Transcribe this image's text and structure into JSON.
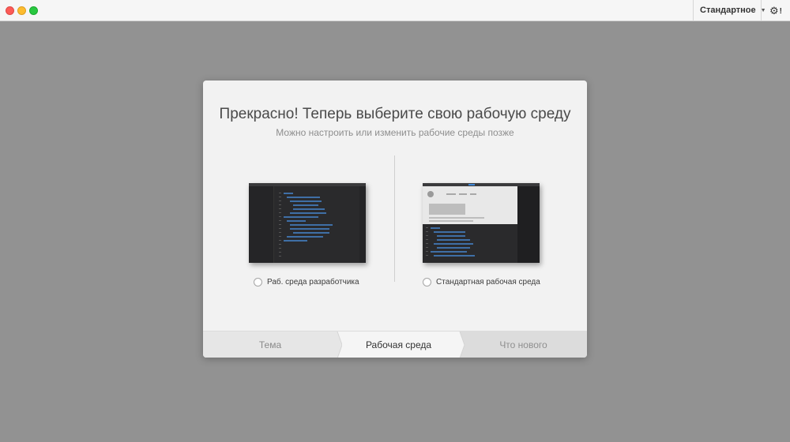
{
  "workspace_select": {
    "label": "Стандартное"
  },
  "settings": {
    "badge": "!"
  },
  "dialog": {
    "title": "Прекрасно! Теперь выберите свою рабочую среду",
    "subtitle": "Можно настроить или изменить рабочие среды позже",
    "options": [
      {
        "label": "Раб. среда разработчика",
        "selected": false
      },
      {
        "label": "Стандартная рабочая среда",
        "selected": false
      }
    ],
    "steps": [
      {
        "label": "Тема",
        "state": "done"
      },
      {
        "label": "Рабочая среда",
        "state": "active"
      },
      {
        "label": "Что нового",
        "state": "upcoming"
      }
    ]
  },
  "icons": {
    "close": "window-close-icon",
    "minimize": "window-minimize-icon",
    "maximize": "window-maximize-icon",
    "settings": "gear-icon",
    "dropdown": "chevron-down-icon"
  },
  "colors": {
    "backdrop": "#929292",
    "dialog_bg": "#f2f2f2",
    "code_accent": "#3f6fa6",
    "close": "#fc5b57",
    "minimize": "#fdbc2e",
    "maximize": "#28c840"
  }
}
